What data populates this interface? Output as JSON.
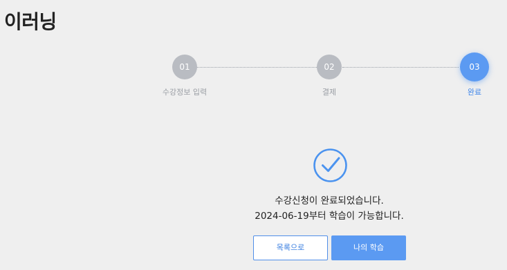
{
  "page": {
    "title": "이러닝"
  },
  "stepper": {
    "steps": [
      {
        "number": "01",
        "label": "수강정보 입력",
        "state": "done"
      },
      {
        "number": "02",
        "label": "결제",
        "state": "done"
      },
      {
        "number": "03",
        "label": "완료",
        "state": "current"
      }
    ],
    "colors": {
      "inactive": "#b9bcc2",
      "active": "#5b9af2"
    }
  },
  "result": {
    "icon": "check-circle-icon",
    "message_line1": "수강신청이 완료되었습니다.",
    "message_line2": "2024-06-19부터 학습이 가능합니다."
  },
  "actions": {
    "list_label": "목록으로",
    "my_learning_label": "나의 학습"
  }
}
